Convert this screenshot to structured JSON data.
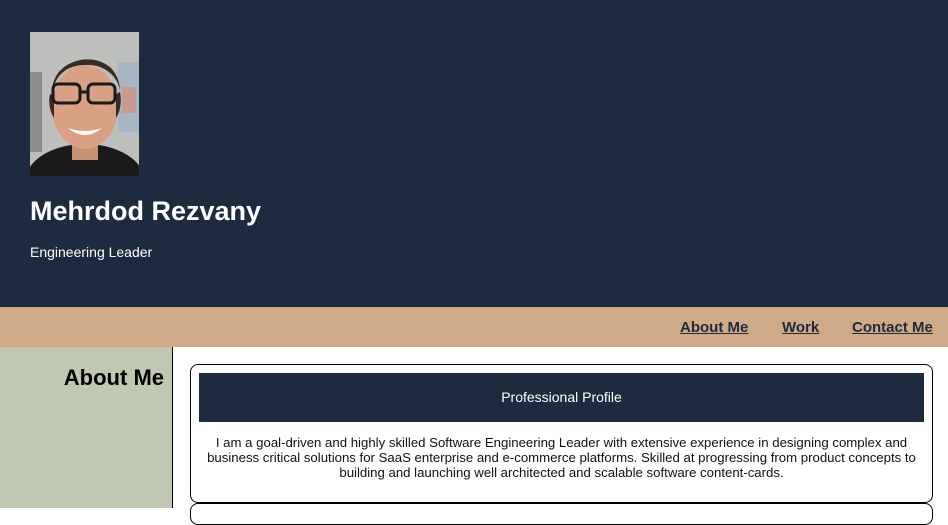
{
  "header": {
    "name": "Mehrdod Rezvany",
    "tagline": "Engineering Leader",
    "background_color": "#1e2a3d",
    "avatar_alt": "profile photo"
  },
  "nav": {
    "background_color": "#ceaa89",
    "items": [
      {
        "label": "About Me"
      },
      {
        "label": "Work"
      },
      {
        "label": "Contact Me"
      }
    ]
  },
  "sidebar": {
    "title": "About Me",
    "background_color": "#c0c8b1"
  },
  "card": {
    "title": "Professional Profile",
    "body": "I am a goal-driven and highly skilled Software Engineering Leader with extensive experience in designing complex and business critical solutions for SaaS enterprise and e-commerce platforms. Skilled at progressing from product concepts to building and launching well architected and scalable software content-cards."
  }
}
